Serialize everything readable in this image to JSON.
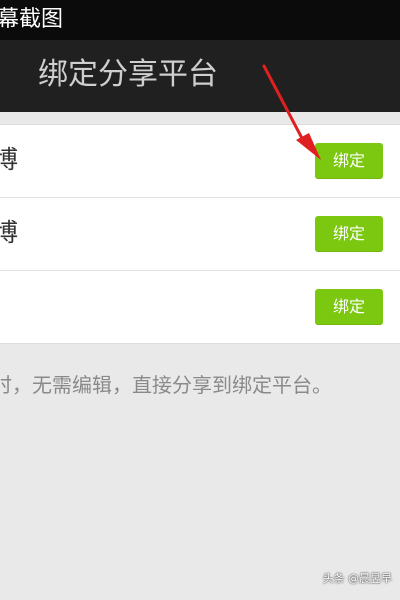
{
  "status_bar": {
    "text": "幕截图"
  },
  "header": {
    "title": "绑定分享平台"
  },
  "platforms": [
    {
      "label": "博",
      "button_label": "绑定"
    },
    {
      "label": "博",
      "button_label": "绑定"
    },
    {
      "label": "",
      "button_label": "绑定"
    }
  ],
  "hint": {
    "text": "时，无需编辑，直接分享到绑定平台。"
  },
  "watermark": {
    "text": "头条 @晨昱早"
  },
  "colors": {
    "status_bar": "#0b0b0b",
    "title_bar": "#202020",
    "background": "#e9e9e9",
    "button_green": "#7cc70f",
    "arrow_red": "#e02020"
  },
  "icons": {
    "annotation_arrow": "red-arrow-icon"
  }
}
